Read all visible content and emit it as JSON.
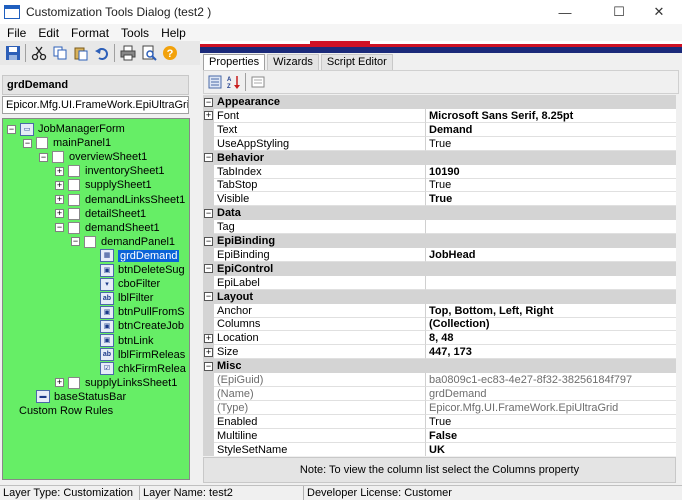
{
  "window": {
    "title": "Customization Tools Dialog  (test2 )",
    "min": "—",
    "max": "☐",
    "close": "✕"
  },
  "menu": [
    "File",
    "Edit",
    "Format",
    "Tools",
    "Help"
  ],
  "left": {
    "selected_name": "grdDemand",
    "selected_type": "Epicor.Mfg.UI.FrameWork.EpiUltraGri",
    "tree": [
      {
        "label": "JobManagerForm",
        "expander": "−",
        "icon": "form",
        "sel": false
      },
      {
        "label": "mainPanel1",
        "expander": "−",
        "icon": "box",
        "sel": false
      },
      {
        "label": "overviewSheet1",
        "expander": "−",
        "icon": "box",
        "sel": false
      },
      {
        "label": "inventorySheet1",
        "expander": "+",
        "icon": "box",
        "sel": false
      },
      {
        "label": "supplySheet1",
        "expander": "+",
        "icon": "box",
        "sel": false
      },
      {
        "label": "demandLinksSheet1",
        "expander": "+",
        "icon": "box",
        "sel": false
      },
      {
        "label": "detailSheet1",
        "expander": "+",
        "icon": "box",
        "sel": false
      },
      {
        "label": "demandSheet1",
        "expander": "−",
        "icon": "box",
        "sel": false
      },
      {
        "label": "demandPanel1",
        "expander": "−",
        "icon": "box",
        "sel": false
      },
      {
        "label": "grdDemand",
        "expander": "",
        "icon": "grid",
        "sel": true
      },
      {
        "label": "btnDeleteSug",
        "expander": "",
        "icon": "btn",
        "sel": false
      },
      {
        "label": "cboFilter",
        "expander": "",
        "icon": "combo",
        "sel": false
      },
      {
        "label": "lblFilter",
        "expander": "",
        "icon": "ab",
        "sel": false
      },
      {
        "label": "btnPullFromS",
        "expander": "",
        "icon": "btn",
        "sel": false
      },
      {
        "label": "btnCreateJob",
        "expander": "",
        "icon": "btn",
        "sel": false
      },
      {
        "label": "btnLink",
        "expander": "",
        "icon": "btn",
        "sel": false
      },
      {
        "label": "lblFirmReleas",
        "expander": "",
        "icon": "ab",
        "sel": false
      },
      {
        "label": "chkFirmRelea",
        "expander": "",
        "icon": "check",
        "sel": false
      },
      {
        "label": "supplyLinksSheet1",
        "expander": "+",
        "icon": "box",
        "sel": false
      },
      {
        "label": "baseStatusBar",
        "expander": "",
        "icon": "status",
        "sel": false
      },
      {
        "label": "Custom Row Rules",
        "expander": "",
        "icon": "",
        "sel": false
      }
    ]
  },
  "tabs": [
    "Properties",
    "Wizards",
    "Script Editor"
  ],
  "properties": [
    {
      "type": "cat",
      "name": "Appearance"
    },
    {
      "type": "prop",
      "expander": "+",
      "name": "Font",
      "value": "Microsoft Sans Serif, 8.25pt",
      "bold": true
    },
    {
      "type": "prop",
      "name": "Text",
      "value": "Demand",
      "bold": true
    },
    {
      "type": "prop",
      "name": "UseAppStyling",
      "value": "True"
    },
    {
      "type": "cat",
      "name": "Behavior"
    },
    {
      "type": "prop",
      "name": "TabIndex",
      "value": "10190",
      "bold": true
    },
    {
      "type": "prop",
      "name": "TabStop",
      "value": "True"
    },
    {
      "type": "prop",
      "name": "Visible",
      "value": "True",
      "bold": true
    },
    {
      "type": "cat",
      "name": "Data"
    },
    {
      "type": "prop",
      "name": "Tag",
      "value": ""
    },
    {
      "type": "cat",
      "name": "EpiBinding"
    },
    {
      "type": "prop",
      "name": "EpiBinding",
      "value": "JobHead",
      "bold": true
    },
    {
      "type": "cat",
      "name": "EpiControl"
    },
    {
      "type": "prop",
      "name": "EpiLabel",
      "value": ""
    },
    {
      "type": "cat",
      "name": "Layout"
    },
    {
      "type": "prop",
      "name": "Anchor",
      "value": "Top, Bottom, Left, Right",
      "bold": true
    },
    {
      "type": "prop",
      "name": "Columns",
      "value": "(Collection)",
      "bold": true
    },
    {
      "type": "prop",
      "expander": "+",
      "name": "Location",
      "value": "8, 48",
      "bold": true
    },
    {
      "type": "prop",
      "expander": "+",
      "name": "Size",
      "value": "447, 173",
      "bold": true
    },
    {
      "type": "cat",
      "name": "Misc"
    },
    {
      "type": "prop",
      "name": "(EpiGuid)",
      "value": "ba0809c1-ec83-4e27-8f32-38256184f797",
      "gray": true
    },
    {
      "type": "prop",
      "name": "(Name)",
      "value": "grdDemand",
      "gray": true
    },
    {
      "type": "prop",
      "name": "(Type)",
      "value": "Epicor.Mfg.UI.FrameWork.EpiUltraGrid",
      "gray": true
    },
    {
      "type": "prop",
      "name": "Enabled",
      "value": "True"
    },
    {
      "type": "prop",
      "name": "Multiline",
      "value": "False",
      "bold": true
    },
    {
      "type": "prop",
      "name": "StyleSetName",
      "value": "UK",
      "bold": true
    }
  ],
  "note": "Note:  To view the column list select the Columns property",
  "status": {
    "layer_type": "Layer Type:  Customization",
    "layer_name": "Layer Name:  test2",
    "license": "Developer License:  Customer"
  },
  "colors": {
    "tree_bg": "#66ee66",
    "selection": "#0a64d8",
    "category_bg": "#d4d4d4"
  }
}
